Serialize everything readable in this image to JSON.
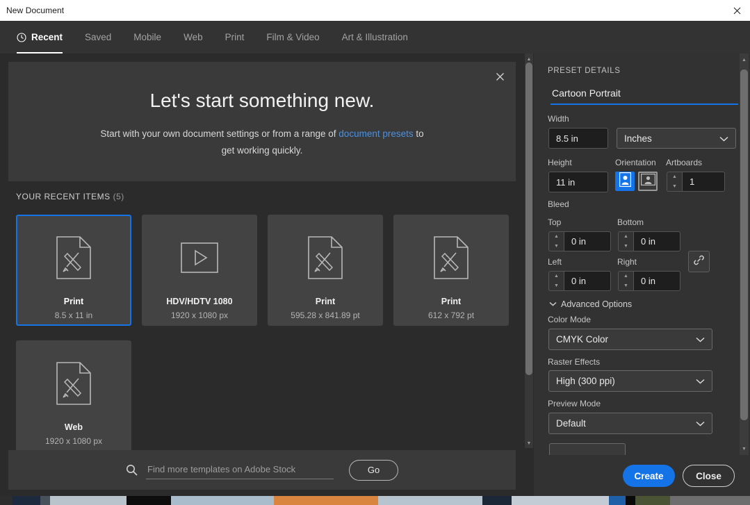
{
  "window": {
    "title": "New Document",
    "close_icon": "close-icon"
  },
  "tabs": [
    {
      "label": "Recent",
      "icon": "clock-icon",
      "active": true
    },
    {
      "label": "Saved",
      "active": false
    },
    {
      "label": "Mobile",
      "active": false
    },
    {
      "label": "Web",
      "active": false
    },
    {
      "label": "Print",
      "active": false
    },
    {
      "label": "Film & Video",
      "active": false
    },
    {
      "label": "Art & Illustration",
      "active": false
    }
  ],
  "banner": {
    "title": "Let's start something new.",
    "text_before": "Start with your own document settings or from a range of ",
    "link": "document presets",
    "text_after": " to get working quickly.",
    "close_icon": "close-icon"
  },
  "recent": {
    "heading": "YOUR RECENT ITEMS",
    "count": "(5)",
    "items": [
      {
        "title": "Print",
        "subtitle": "8.5 x 11 in",
        "icon": "document-pencil-ruler-icon",
        "selected": true
      },
      {
        "title": "HDV/HDTV 1080",
        "subtitle": "1920 x 1080 px",
        "icon": "video-play-icon",
        "selected": false
      },
      {
        "title": "Print",
        "subtitle": "595.28 x 841.89 pt",
        "icon": "document-pencil-ruler-icon",
        "selected": false
      },
      {
        "title": "Print",
        "subtitle": "612 x 792 pt",
        "icon": "document-pencil-ruler-icon",
        "selected": false
      },
      {
        "title": "Web",
        "subtitle": "1920 x 1080 px",
        "icon": "document-pencil-ruler-icon",
        "selected": false
      }
    ]
  },
  "stock": {
    "search_icon": "search-icon",
    "placeholder": "Find more templates on Adobe Stock",
    "value": "",
    "go_label": "Go"
  },
  "preset": {
    "heading": "PRESET DETAILS",
    "name_value": "Cartoon Portrait",
    "width_label": "Width",
    "width_value": "8.5 in",
    "units_value": "Inches",
    "height_label": "Height",
    "height_value": "11 in",
    "orientation_label": "Orientation",
    "orientation_portrait_icon": "portrait-orientation-icon",
    "orientation_landscape_icon": "landscape-orientation-icon",
    "artboards_label": "Artboards",
    "artboards_value": "1",
    "bleed_label": "Bleed",
    "bleed_top_label": "Top",
    "bleed_top_value": "0 in",
    "bleed_bottom_label": "Bottom",
    "bleed_bottom_value": "0 in",
    "bleed_left_label": "Left",
    "bleed_left_value": "0 in",
    "bleed_right_label": "Right",
    "bleed_right_value": "0 in",
    "link_icon": "link-chain-icon",
    "advanced_label": "Advanced Options",
    "color_mode_label": "Color Mode",
    "color_mode_value": "CMYK Color",
    "raster_label": "Raster Effects",
    "raster_value": "High (300 ppi)",
    "preview_label": "Preview Mode",
    "preview_value": "Default"
  },
  "footer": {
    "create_label": "Create",
    "close_label": "Close"
  },
  "colors": {
    "accent_blue": "#1473e6",
    "link_blue": "#4b91e2",
    "panel_bg": "#323232",
    "page_bg": "#2b2b2b",
    "card_bg": "#434343",
    "tabbar_bg": "#333333"
  }
}
